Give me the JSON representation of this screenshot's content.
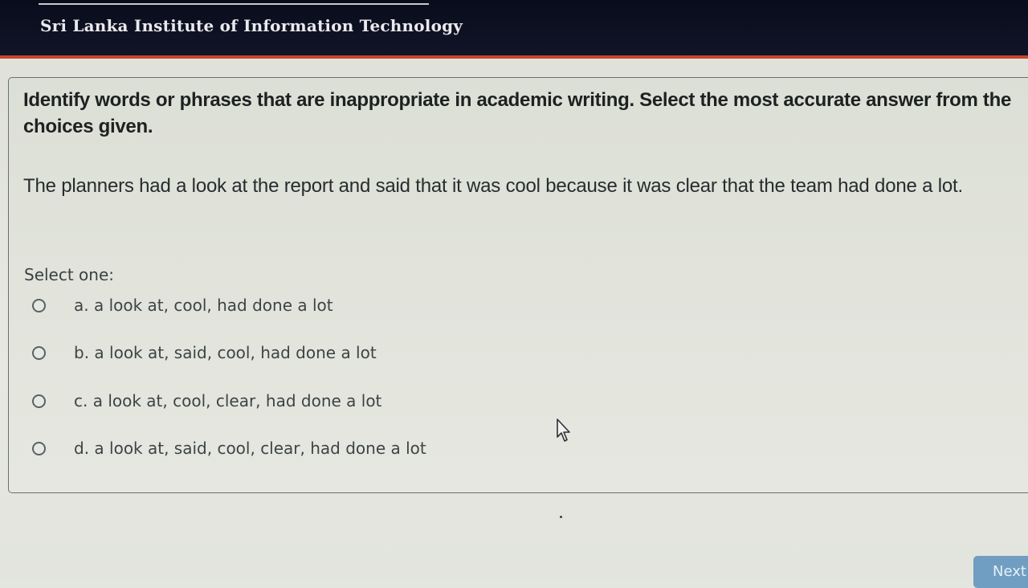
{
  "header": {
    "institution": "Sri Lanka Institute of Information Technology"
  },
  "question": {
    "prompt": "Identify words or phrases that are inappropriate in academic writing. Select the most accurate answer from the choices given.",
    "sentence": "The planners had a look at the report and said that it was cool because it was clear that the team had done a lot.",
    "select_label": "Select one:",
    "options": [
      {
        "text": "a. a look at, cool, had done a lot",
        "selected": false
      },
      {
        "text": "b. a look at, said, cool, had done a lot",
        "selected": false
      },
      {
        "text": "c. a look at, cool, clear, had done a lot",
        "selected": false
      },
      {
        "text": "d. a look at, said, cool, clear, had done a lot",
        "selected": false
      }
    ]
  },
  "navigation": {
    "next_label": "Next"
  },
  "icons": {
    "cursor": "mouse-pointer-icon",
    "radio": "radio-unchecked-icon"
  },
  "colors": {
    "header_bg": "#0a0c1c",
    "accent": "#c8452f",
    "button": "#6f9ec2"
  }
}
